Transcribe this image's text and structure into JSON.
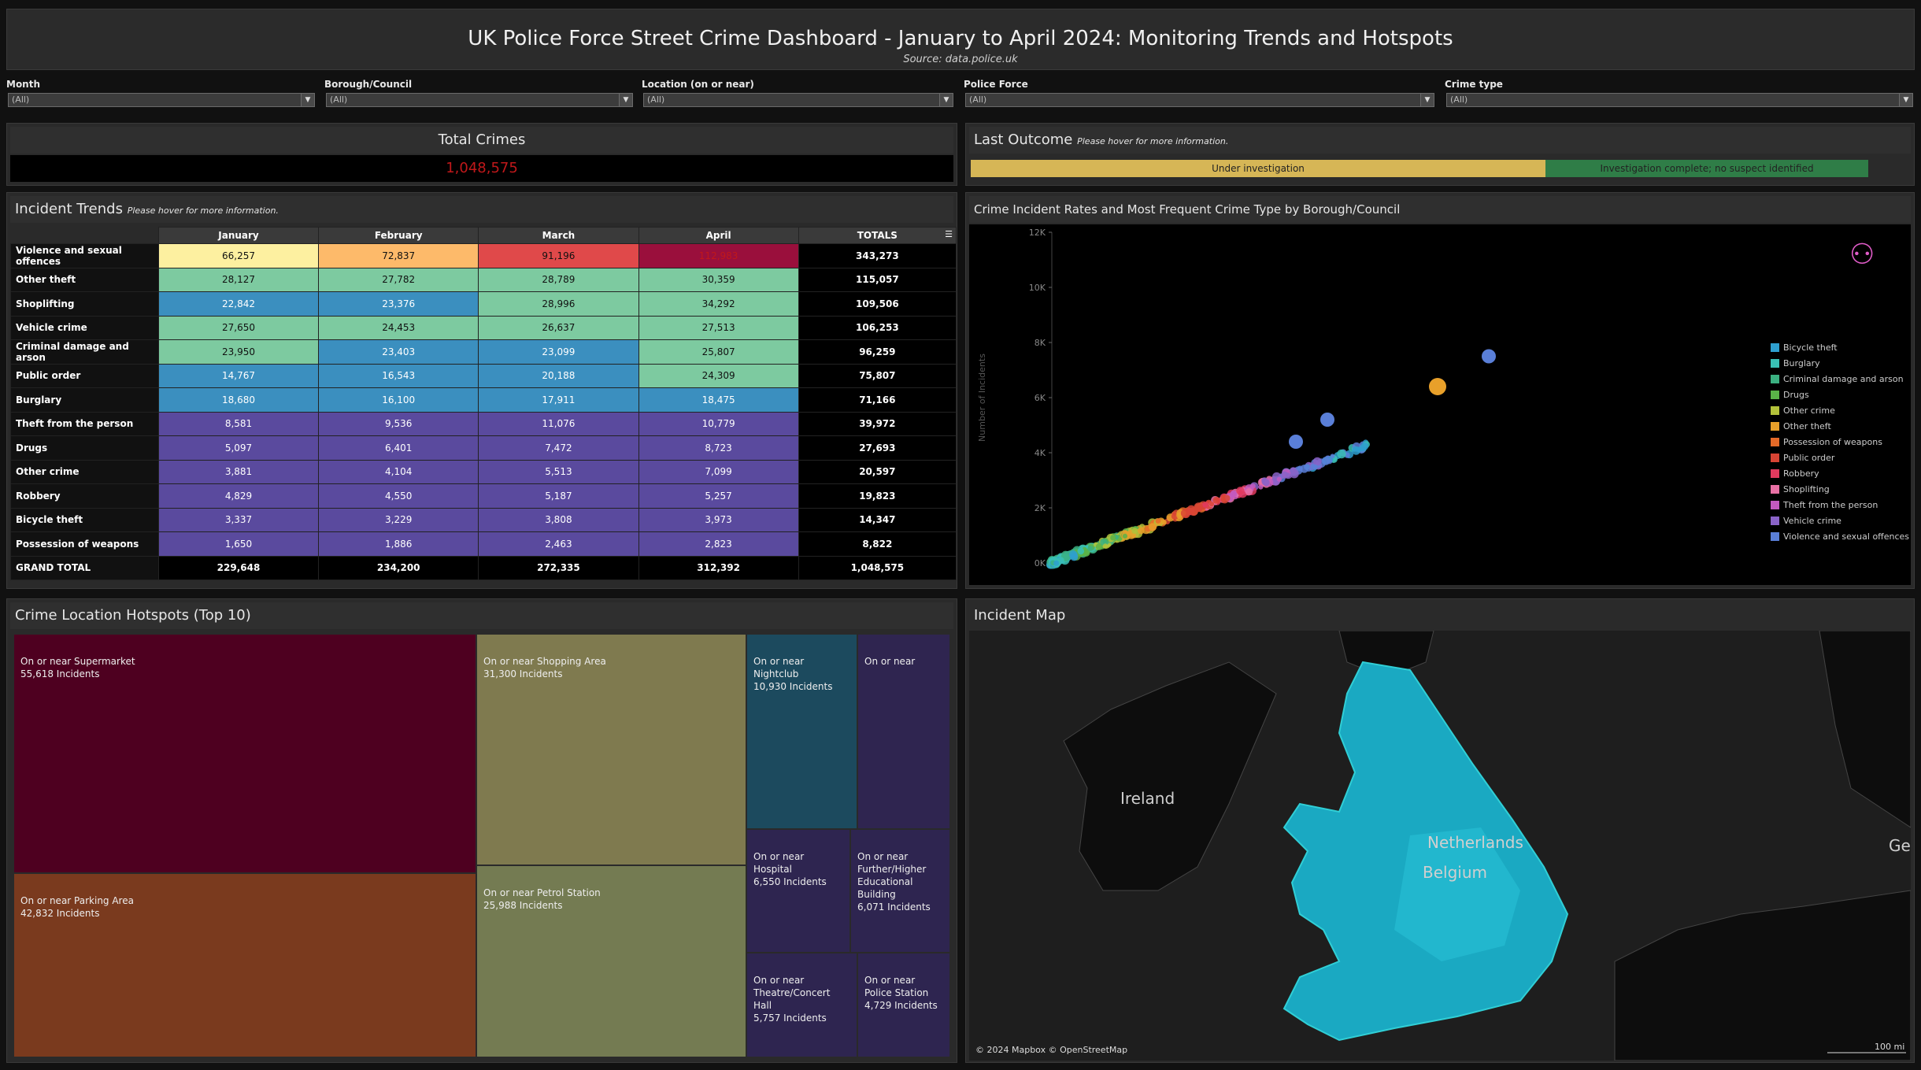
{
  "header": {
    "title": "UK Police Force Street Crime Dashboard - January to April 2024: Monitoring Trends and Hotspots",
    "source": "Source: data.police.uk"
  },
  "filters": [
    {
      "label": "Month",
      "value": "(All)"
    },
    {
      "label": "Borough/Council",
      "value": "(All)"
    },
    {
      "label": "Location (on or near)",
      "value": "(All)"
    },
    {
      "label": "Police Force",
      "value": "(All)"
    },
    {
      "label": "Crime type",
      "value": "(All)"
    }
  ],
  "kpi": {
    "label": "Total Crimes",
    "value": "1,048,575"
  },
  "outcome": {
    "title": "Last Outcome",
    "hint": "Please hover for more information.",
    "segments": [
      {
        "label": "Under investigation",
        "share": 0.64,
        "color": "#d6b656"
      },
      {
        "label": "Investigation complete; no suspect identified",
        "share": 0.36,
        "color": "#2f7d47"
      }
    ]
  },
  "trends": {
    "title": "Incident Trends",
    "hint": "Please hover for more information.",
    "columns": [
      "January",
      "February",
      "March",
      "April",
      "TOTALS"
    ],
    "rows": [
      {
        "label": "Violence and sexual offences",
        "cells": [
          "66,257",
          "72,837",
          "91,196",
          "112,983"
        ],
        "colors": [
          "#fdf0a0",
          "#fdba6a",
          "#e0494a",
          "#9a0f3c"
        ],
        "total": "343,273"
      },
      {
        "label": "Other theft",
        "cells": [
          "28,127",
          "27,782",
          "28,789",
          "30,359"
        ],
        "colors": [
          "#7dcaa0",
          "#7dcaa0",
          "#7dcaa0",
          "#7dcaa0"
        ],
        "total": "115,057"
      },
      {
        "label": "Shoplifting",
        "cells": [
          "22,842",
          "23,376",
          "28,996",
          "34,292"
        ],
        "colors": [
          "#3b8fbf",
          "#3b8fbf",
          "#7dcaa0",
          "#7dcaa0"
        ],
        "total": "109,506"
      },
      {
        "label": "Vehicle crime",
        "cells": [
          "27,650",
          "24,453",
          "26,637",
          "27,513"
        ],
        "colors": [
          "#7dcaa0",
          "#7dcaa0",
          "#7dcaa0",
          "#7dcaa0"
        ],
        "total": "106,253"
      },
      {
        "label": "Criminal damage and arson",
        "cells": [
          "23,950",
          "23,403",
          "23,099",
          "25,807"
        ],
        "colors": [
          "#7dcaa0",
          "#3b8fbf",
          "#3b8fbf",
          "#7dcaa0"
        ],
        "total": "96,259"
      },
      {
        "label": "Public order",
        "cells": [
          "14,767",
          "16,543",
          "20,188",
          "24,309"
        ],
        "colors": [
          "#3b8fbf",
          "#3b8fbf",
          "#3b8fbf",
          "#7dcaa0"
        ],
        "total": "75,807"
      },
      {
        "label": "Burglary",
        "cells": [
          "18,680",
          "16,100",
          "17,911",
          "18,475"
        ],
        "colors": [
          "#3b8fbf",
          "#3b8fbf",
          "#3b8fbf",
          "#3b8fbf"
        ],
        "total": "71,166"
      },
      {
        "label": "Theft from the person",
        "cells": [
          "8,581",
          "9,536",
          "11,076",
          "10,779"
        ],
        "colors": [
          "#5a4a9e",
          "#5a4a9e",
          "#5a4a9e",
          "#5a4a9e"
        ],
        "total": "39,972"
      },
      {
        "label": "Drugs",
        "cells": [
          "5,097",
          "6,401",
          "7,472",
          "8,723"
        ],
        "colors": [
          "#5a4a9e",
          "#5a4a9e",
          "#5a4a9e",
          "#5a4a9e"
        ],
        "total": "27,693"
      },
      {
        "label": "Other crime",
        "cells": [
          "3,881",
          "4,104",
          "5,513",
          "7,099"
        ],
        "colors": [
          "#5a4a9e",
          "#5a4a9e",
          "#5a4a9e",
          "#5a4a9e"
        ],
        "total": "20,597"
      },
      {
        "label": "Robbery",
        "cells": [
          "4,829",
          "4,550",
          "5,187",
          "5,257"
        ],
        "colors": [
          "#5a4a9e",
          "#5a4a9e",
          "#5a4a9e",
          "#5a4a9e"
        ],
        "total": "19,823"
      },
      {
        "label": "Bicycle theft",
        "cells": [
          "3,337",
          "3,229",
          "3,808",
          "3,973"
        ],
        "colors": [
          "#5a4a9e",
          "#5a4a9e",
          "#5a4a9e",
          "#5a4a9e"
        ],
        "total": "14,347"
      },
      {
        "label": "Possession of weapons",
        "cells": [
          "1,650",
          "1,886",
          "2,463",
          "2,823"
        ],
        "colors": [
          "#5a4a9e",
          "#5a4a9e",
          "#5a4a9e",
          "#5a4a9e"
        ],
        "total": "8,822"
      }
    ],
    "grand_total": {
      "label": "GRAND TOTAL",
      "cells": [
        "229,648",
        "234,200",
        "272,335",
        "312,392"
      ],
      "total": "1,048,575"
    }
  },
  "scatter": {
    "title": "Crime Incident Rates and Most Frequent Crime Type by Borough/Council",
    "ylabel": "Number of Incidents",
    "yticks": [
      "0K",
      "2K",
      "4K",
      "6K",
      "8K",
      "10K",
      "12K"
    ],
    "legend": [
      {
        "name": "Bicycle theft",
        "color": "#2e9fcf"
      },
      {
        "name": "Burglary",
        "color": "#39c0b5"
      },
      {
        "name": "Criminal damage and arson",
        "color": "#3bb081"
      },
      {
        "name": "Drugs",
        "color": "#5ab348"
      },
      {
        "name": "Other crime",
        "color": "#b3c23a"
      },
      {
        "name": "Other theft",
        "color": "#e8a02a"
      },
      {
        "name": "Possession of weapons",
        "color": "#e56a28"
      },
      {
        "name": "Public order",
        "color": "#d84434"
      },
      {
        "name": "Robbery",
        "color": "#e03a5e"
      },
      {
        "name": "Shoplifting",
        "color": "#e870a4"
      },
      {
        "name": "Theft from the person",
        "color": "#c35ac0"
      },
      {
        "name": "Vehicle crime",
        "color": "#8a63c8"
      },
      {
        "name": "Violence and sexual offences",
        "color": "#5a7fd8"
      }
    ]
  },
  "chart_data": {
    "type": "scatter",
    "title": "Crime Incident Rates and Most Frequent Crime Type by Borough/Council",
    "ylabel": "Number of Incidents",
    "ylim": [
      0,
      12000
    ],
    "highlight_points": [
      {
        "y": 7500,
        "series": "Violence and sexual offences"
      },
      {
        "y": 6400,
        "series": "Other theft"
      },
      {
        "y": 5200,
        "series": "Violence and sexual offences"
      },
      {
        "y": 4400,
        "series": "Violence and sexual offences"
      }
    ]
  },
  "hotspots": {
    "title": "Crime Location Hotspots (Top 10)",
    "items": [
      {
        "name": "On or near Supermarket",
        "count": "55,618 Incidents",
        "color": "#4e0020"
      },
      {
        "name": "On or near Parking Area",
        "count": "42,832 Incidents",
        "color": "#7a3a1e"
      },
      {
        "name": "On or near Shopping Area",
        "count": "31,300 Incidents",
        "color": "#7f7a4f"
      },
      {
        "name": "On or near Petrol Station",
        "count": "25,988 Incidents",
        "color": "#747b52"
      },
      {
        "name": "On or near Nightclub",
        "count": "10,930 Incidents",
        "color": "#1c4a5e"
      },
      {
        "name": "On or near",
        "count": "",
        "color": "#2f2550"
      },
      {
        "name": "On or near Hospital",
        "count": "6,550 Incidents",
        "color": "#2e2550"
      },
      {
        "name": "On or near Further/Higher Educational Building",
        "count": "6,071 Incidents",
        "color": "#2e2550"
      },
      {
        "name": "On or near Theatre/Concert Hall",
        "count": "5,757 Incidents",
        "color": "#2e2550"
      },
      {
        "name": "On or near Police Station",
        "count": "4,729 Incidents",
        "color": "#2e2550"
      }
    ]
  },
  "map": {
    "title": "Incident Map",
    "labels": [
      "Ireland",
      "Netherlands",
      "Belgium",
      "Ge"
    ],
    "attribution": "© 2024 Mapbox © OpenStreetMap",
    "scale": "100 mi"
  }
}
